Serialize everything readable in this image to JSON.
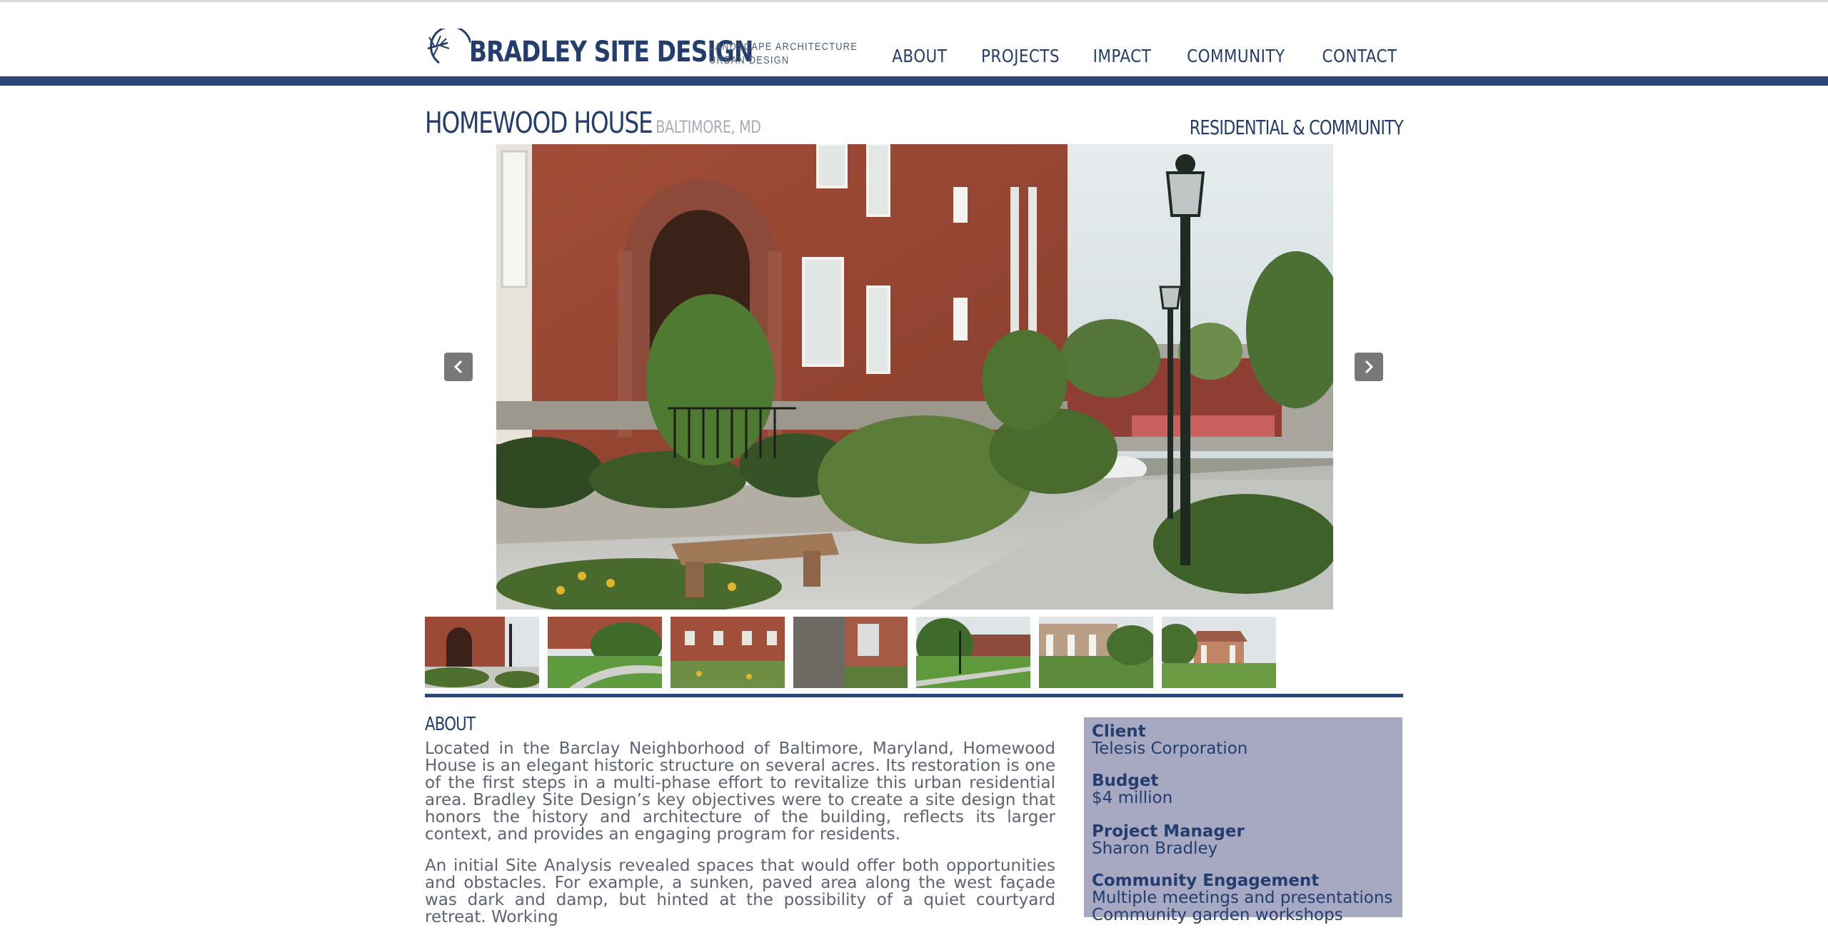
{
  "brand": {
    "name": "BRADLEY SITE DESIGN",
    "tagline_1": "LANDSCAPE ARCHITECTURE",
    "tagline_2": "URBAN DESIGN"
  },
  "nav": {
    "items": [
      "ABOUT",
      "PROJECTS",
      "IMPACT",
      "COMMUNITY",
      "CONTACT"
    ]
  },
  "project": {
    "title": "HOMEWOOD HOUSE",
    "location": "BALTIMORE, MD",
    "category": "RESIDENTIAL & COMMUNITY"
  },
  "gallery": {
    "thumbnail_count": 7
  },
  "about": {
    "heading": "ABOUT",
    "paragraph_1": "Located in the Barclay Neighborhood of Baltimore, Maryland, Homewood House is an elegant historic structure on several acres. Its restoration is one of the first steps in a multi-phase effort to revitalize this urban residential area. Bradley Site Design’s key objectives were to create a site design that honors the history and architecture of the building, reflects its larger context, and provides an engaging program for residents.",
    "paragraph_2": "An initial Site Analysis revealed spaces that would offer both opportunities and obstacles. For example, a sunken, paved area along the west façade was dark and damp, but hinted at the possibility of a quiet courtyard retreat. Working"
  },
  "details": {
    "client_label": "Client",
    "client_value": "Telesis Corporation",
    "budget_label": "Budget",
    "budget_value": "$4 million",
    "manager_label": "Project Manager",
    "manager_value": "Sharon Bradley",
    "engagement_label": "Community Engagement",
    "engagement_value": "Multiple meetings and presentations",
    "engagement_value_2": "Community garden workshops"
  },
  "colors": {
    "brand_navy": "#233e6e",
    "bar_navy": "#2b4778",
    "sidebar_bg": "#a7a8c2",
    "body_text": "#5e6373",
    "location_gray": "#a9acb6"
  },
  "icons": {
    "logo": "dragonfly-sun-logo-icon",
    "prev": "chevron-left-icon",
    "next": "chevron-right-icon"
  }
}
